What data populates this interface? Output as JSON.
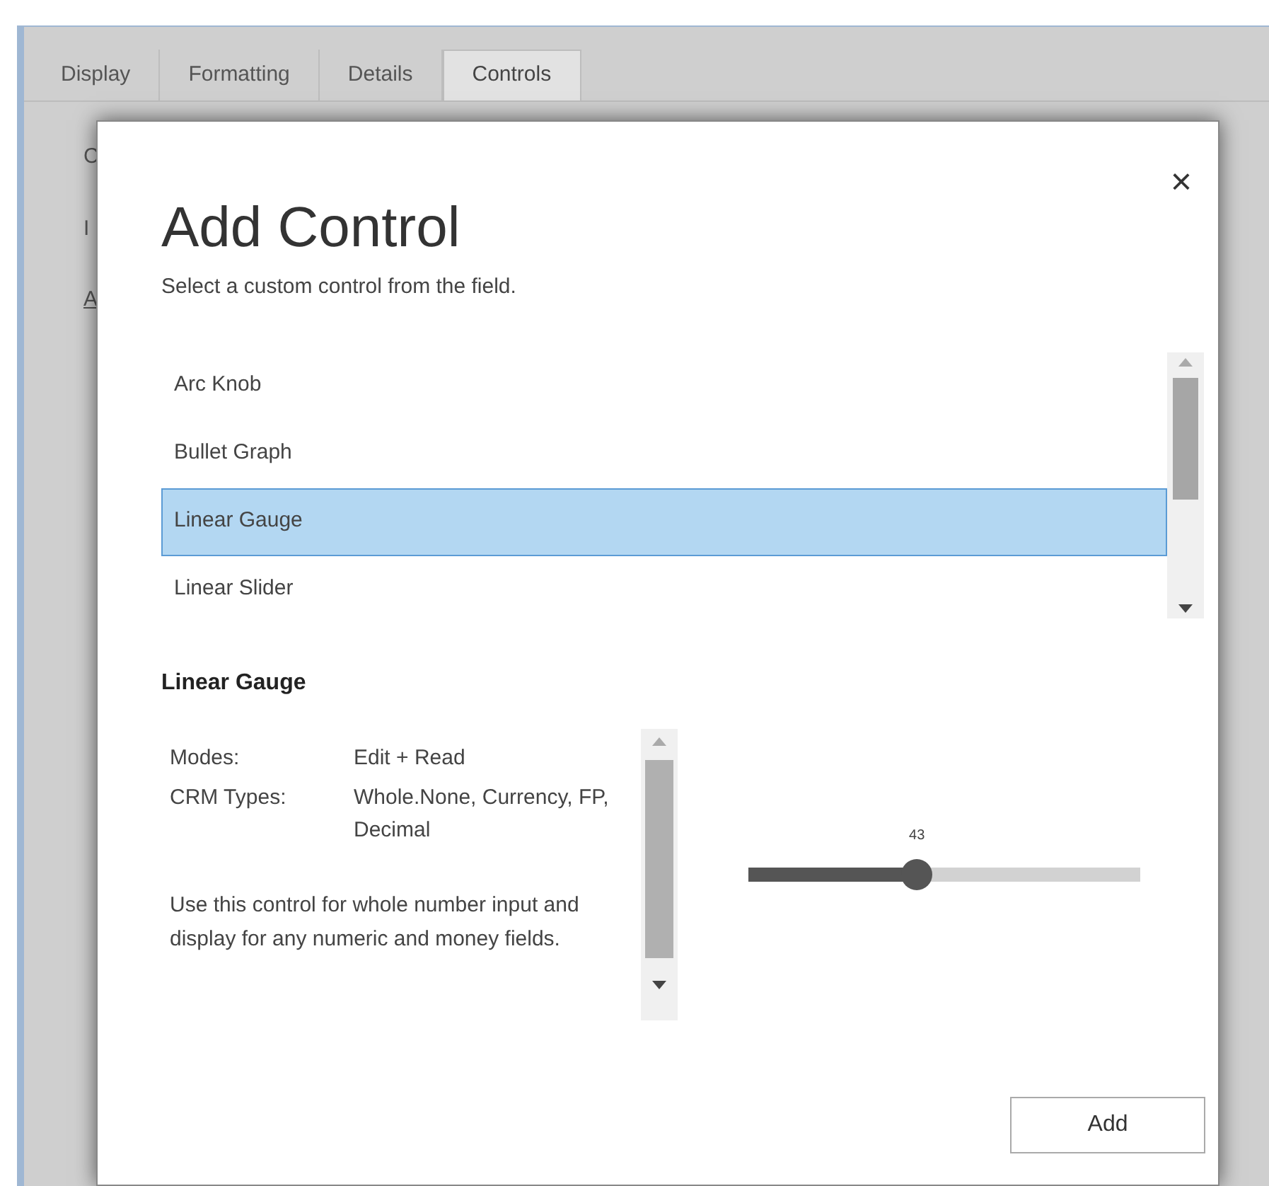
{
  "tabs": [
    {
      "label": "Display",
      "selected": false
    },
    {
      "label": "Formatting",
      "selected": false
    },
    {
      "label": "Details",
      "selected": false
    },
    {
      "label": "Controls",
      "selected": true
    }
  ],
  "background_fragments": [
    "C",
    "I",
    "A"
  ],
  "dialog": {
    "title": "Add Control",
    "subtitle": "Select a custom control from the field.",
    "close": "×",
    "controls": [
      {
        "label": "Arc Knob",
        "selected": false
      },
      {
        "label": "Bullet Graph",
        "selected": false
      },
      {
        "label": "Linear Gauge",
        "selected": true
      },
      {
        "label": "Linear Slider",
        "selected": false
      }
    ],
    "details": {
      "title": "Linear Gauge",
      "properties": [
        {
          "label": "Modes:",
          "value": "Edit + Read"
        },
        {
          "label": "CRM Types:",
          "value": "Whole.None, Currency, FP, Decimal"
        }
      ],
      "description": "Use this control for whole number input and display for any numeric and money fields."
    },
    "preview_slider": {
      "reading": "43",
      "level": 0.43
    },
    "button": "Add"
  }
}
